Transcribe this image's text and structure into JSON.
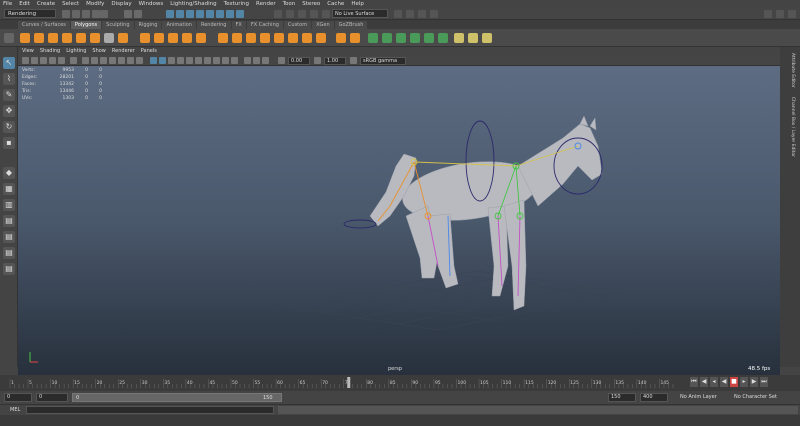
{
  "menubar": [
    "File",
    "Edit",
    "Create",
    "Select",
    "Modify",
    "Display",
    "Windows",
    "Lighting/Shading",
    "Texturing",
    "Render",
    "Toon",
    "Stereo",
    "Cache",
    "Help"
  ],
  "status": {
    "workspace": "Rendering",
    "live_surface": "No Live Surface"
  },
  "shelf_tabs": [
    "Curves / Surfaces",
    "Polygons",
    "Sculpting",
    "Rigging",
    "Animation",
    "Rendering",
    "FX",
    "FX Caching",
    "Custom",
    "XGen",
    "GoZBrush"
  ],
  "active_shelf_tab": "Polygons",
  "panel_menu": [
    "View",
    "Shading",
    "Lighting",
    "Show",
    "Renderer",
    "Panels"
  ],
  "panel_toolbar": {
    "exposure": "0.00",
    "gamma": "1.00",
    "colorspace": "sRGB gamma"
  },
  "hud": {
    "rows": [
      {
        "label": "Verts:",
        "values": [
          "9953",
          "0",
          "0"
        ]
      },
      {
        "label": "Edges:",
        "values": [
          "28201",
          "0",
          "0"
        ]
      },
      {
        "label": "Faces:",
        "values": [
          "13342",
          "0",
          "0"
        ]
      },
      {
        "label": "Tris:",
        "values": [
          "13446",
          "0",
          "0"
        ]
      },
      {
        "label": "UVs:",
        "values": [
          "1303",
          "0",
          "0"
        ]
      }
    ],
    "camera": "persp",
    "fps": "48.5 fps"
  },
  "right_tabs": [
    "Attribute Editor",
    "Channel Box / Layer Editor"
  ],
  "timeline": {
    "ticks": [
      "1",
      "5",
      "10",
      "15",
      "20",
      "25",
      "30",
      "35",
      "40",
      "45",
      "50",
      "55",
      "60",
      "65",
      "70",
      "75",
      "80",
      "85",
      "90",
      "95",
      "100",
      "105",
      "110",
      "115",
      "120",
      "125",
      "130",
      "135",
      "140",
      "145"
    ],
    "current_frame": "1",
    "playhead_frame": 76
  },
  "range": {
    "start": "0",
    "min": "0",
    "inner_start": "0",
    "inner_end": "150",
    "end": "150",
    "max": "400",
    "anim_layer": "No Anim Layer",
    "char_set": "No Character Set"
  },
  "cmdline": {
    "label": "MEL"
  },
  "colors": {
    "accent_orange": "#e8912c",
    "active_tab": "#5d5d5d",
    "selection_blue": "#5285a6"
  }
}
